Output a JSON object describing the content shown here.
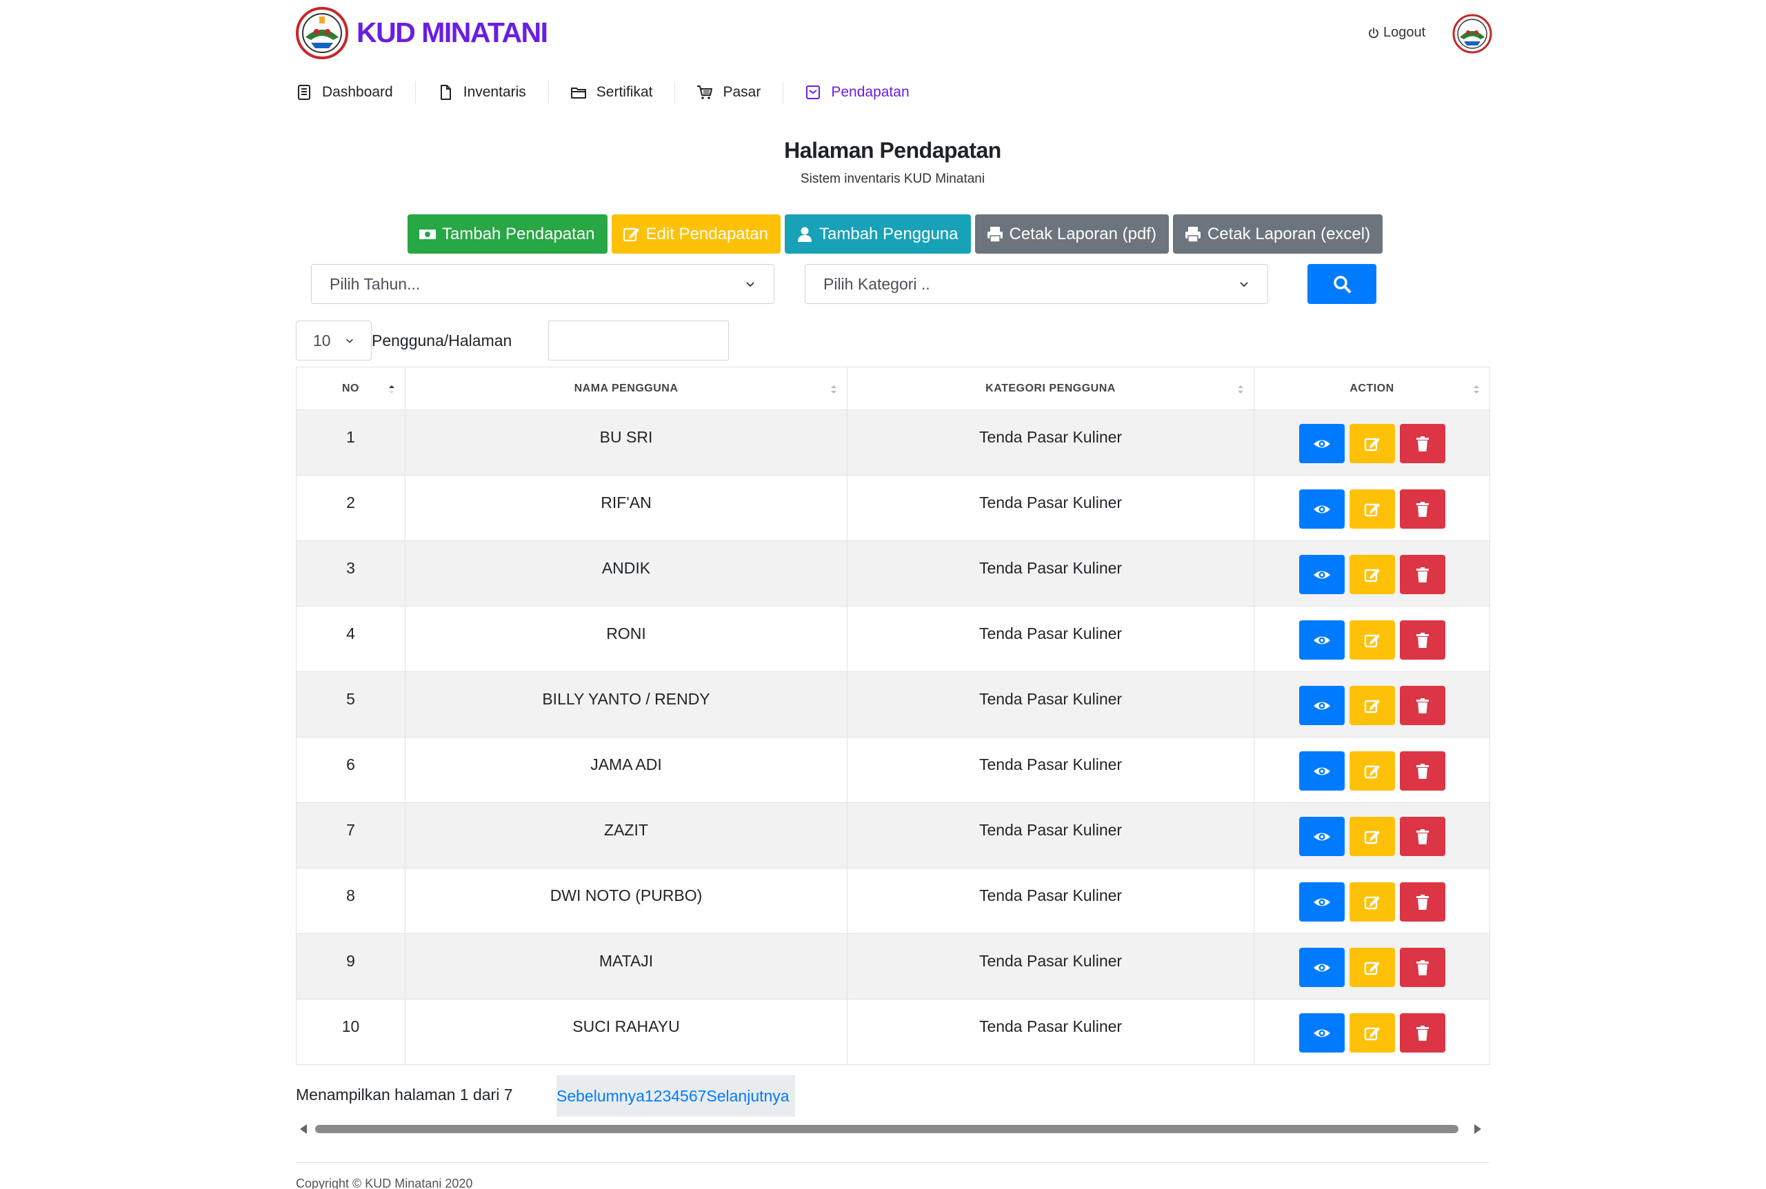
{
  "header": {
    "brand": "KUD MINATANI",
    "logout_label": "Logout"
  },
  "nav": {
    "items": [
      {
        "label": "Dashboard",
        "icon": "document-list-icon"
      },
      {
        "label": "Inventaris",
        "icon": "file-icon"
      },
      {
        "label": "Sertifikat",
        "icon": "folder-icon"
      },
      {
        "label": "Pasar",
        "icon": "cart-icon"
      },
      {
        "label": "Pendapatan",
        "icon": "inbox-icon",
        "active": true
      }
    ]
  },
  "page": {
    "title": "Halaman Pendapatan",
    "subtitle": "Sistem inventaris KUD Minatani"
  },
  "actions": {
    "tambah_pendapatan": "Tambah Pendapatan",
    "edit_pendapatan": "Edit Pendapatan",
    "tambah_pengguna": "Tambah Pengguna",
    "cetak_pdf": "Cetak Laporan (pdf)",
    "cetak_excel": "Cetak Laporan (excel)"
  },
  "filters": {
    "tahun_placeholder": "Pilih Tahun...",
    "kategori_placeholder": "Pilih Kategori .."
  },
  "length": {
    "value": "10",
    "label": "Pengguna/Halaman"
  },
  "table": {
    "headers": {
      "no": "NO",
      "nama": "NAMA PENGGUNA",
      "kategori": "KATEGORI PENGGUNA",
      "action": "ACTION"
    },
    "rows": [
      {
        "no": "1",
        "nama": "BU SRI",
        "kategori": "Tenda Pasar Kuliner"
      },
      {
        "no": "2",
        "nama": "RIF'AN",
        "kategori": "Tenda Pasar Kuliner"
      },
      {
        "no": "3",
        "nama": "ANDIK",
        "kategori": "Tenda Pasar Kuliner"
      },
      {
        "no": "4",
        "nama": "RONI",
        "kategori": "Tenda Pasar Kuliner"
      },
      {
        "no": "5",
        "nama": "BILLY YANTO / RENDY",
        "kategori": "Tenda Pasar Kuliner"
      },
      {
        "no": "6",
        "nama": "JAMA ADI",
        "kategori": "Tenda Pasar Kuliner"
      },
      {
        "no": "7",
        "nama": "ZAZIT",
        "kategori": "Tenda Pasar Kuliner"
      },
      {
        "no": "8",
        "nama": "DWI NOTO (PURBO)",
        "kategori": "Tenda Pasar Kuliner"
      },
      {
        "no": "9",
        "nama": "MATAJI",
        "kategori": "Tenda Pasar Kuliner"
      },
      {
        "no": "10",
        "nama": "SUCI RAHAYU",
        "kategori": "Tenda Pasar Kuliner"
      }
    ]
  },
  "pagination": {
    "info": "Menampilkan halaman 1 dari 7",
    "links": "Sebelumnya1234567Selanjutnya"
  },
  "footer": {
    "copyright": "Copyright © KUD Minatani 2020"
  },
  "colors": {
    "brand": "#6a1de3",
    "primary": "#007bff",
    "success": "#28a745",
    "warning": "#ffc107",
    "info": "#17a2b8",
    "secondary": "#6c757d",
    "danger": "#dc3545"
  }
}
